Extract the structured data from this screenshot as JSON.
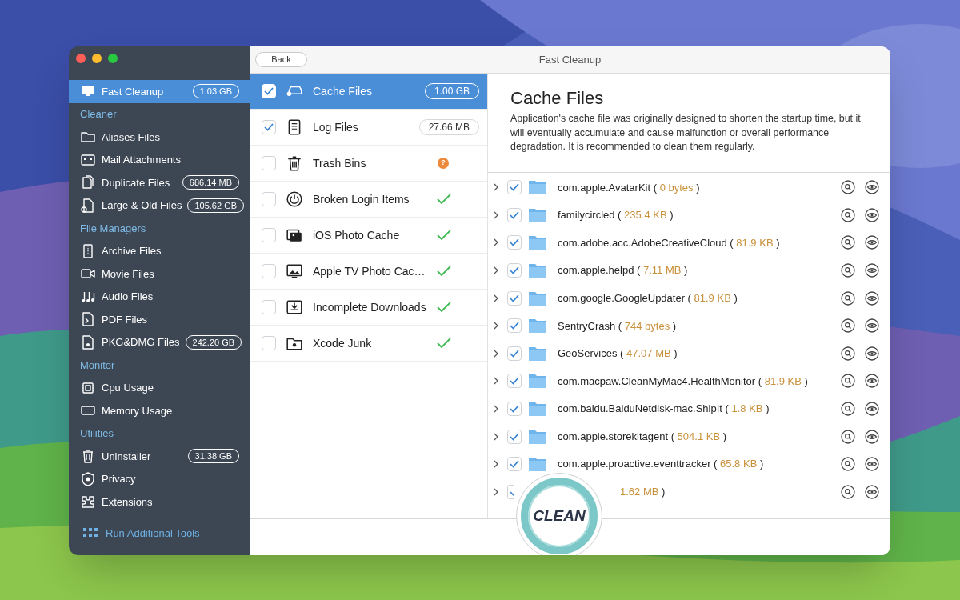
{
  "window": {
    "title": "Fast Cleanup"
  },
  "sidebar": {
    "entries": [
      {
        "kind": "item",
        "label": "Fast Cleanup",
        "badge": "1.03 GB",
        "selected": true
      },
      {
        "kind": "heading",
        "label": "Cleaner"
      },
      {
        "kind": "item",
        "label": "Aliases Files",
        "selected": false
      },
      {
        "kind": "item",
        "label": "Mail Attachments",
        "selected": false
      },
      {
        "kind": "item",
        "label": "Duplicate Files",
        "badge": "686.14 MB",
        "selected": false
      },
      {
        "kind": "item",
        "label": "Large & Old Files",
        "badge": "105.62 GB",
        "selected": false
      },
      {
        "kind": "heading",
        "label": "File Managers"
      },
      {
        "kind": "item",
        "label": "Archive Files",
        "selected": false
      },
      {
        "kind": "item",
        "label": "Movie Files",
        "selected": false
      },
      {
        "kind": "item",
        "label": "Audio Files",
        "selected": false
      },
      {
        "kind": "item",
        "label": "PDF Files",
        "selected": false
      },
      {
        "kind": "item",
        "label": "PKG&DMG Files",
        "badge": "242.20 GB",
        "selected": false
      },
      {
        "kind": "heading",
        "label": "Monitor"
      },
      {
        "kind": "item",
        "label": "Cpu Usage",
        "selected": false
      },
      {
        "kind": "item",
        "label": "Memory Usage",
        "selected": false
      },
      {
        "kind": "heading",
        "label": "Utilities"
      },
      {
        "kind": "item",
        "label": "Uninstaller",
        "badge": "31.38 GB",
        "selected": false
      },
      {
        "kind": "item",
        "label": "Privacy",
        "selected": false
      },
      {
        "kind": "item",
        "label": "Extensions",
        "selected": false
      }
    ],
    "footer_link": "Run Additional Tools"
  },
  "back_button": "Back",
  "categories": [
    {
      "label": "Cache Files",
      "checked": true,
      "selected": true,
      "kind": "size",
      "size": "1.00 GB"
    },
    {
      "label": "Log Files",
      "checked": true,
      "selected": false,
      "kind": "size",
      "size": "27.66 MB"
    },
    {
      "label": "Trash Bins",
      "checked": false,
      "selected": false,
      "kind": "unknown",
      "mark": "?"
    },
    {
      "label": "Broken Login Items",
      "checked": false,
      "selected": false,
      "kind": "ok"
    },
    {
      "label": "iOS Photo Cache",
      "checked": false,
      "selected": false,
      "kind": "ok"
    },
    {
      "label": "Apple TV Photo Cac…",
      "checked": false,
      "selected": false,
      "kind": "ok"
    },
    {
      "label": "Incomplete Downloads",
      "checked": false,
      "selected": false,
      "kind": "ok"
    },
    {
      "label": "Xcode Junk",
      "checked": false,
      "selected": false,
      "kind": "ok"
    }
  ],
  "detail": {
    "title": "Cache Files",
    "description": "Application's cache file was originally designed to shorten the startup time, but it will eventually accumulate and cause malfunction or overall performance degradation. It is recommended to clean them regularly."
  },
  "files": [
    {
      "label": "com.apple.AvatarKit (",
      "size": "0 bytes",
      "suffix": ")",
      "checked": true
    },
    {
      "label": "familycircled (",
      "size": "235.4 KB",
      "suffix": ")",
      "checked": true
    },
    {
      "label": "com.adobe.acc.AdobeCreativeCloud (",
      "size": "81.9 KB",
      "suffix": ")",
      "checked": true
    },
    {
      "label": "com.apple.helpd (",
      "size": "7.11 MB",
      "suffix": ")",
      "checked": true
    },
    {
      "label": "com.google.GoogleUpdater (",
      "size": "81.9 KB",
      "suffix": ")",
      "checked": true
    },
    {
      "label": "SentryCrash (",
      "size": "744 bytes",
      "suffix": ")",
      "checked": true
    },
    {
      "label": "GeoServices (",
      "size": "47.07 MB",
      "suffix": ")",
      "checked": true
    },
    {
      "label": "com.macpaw.CleanMyMac4.HealthMonitor (",
      "size": "81.9 KB",
      "suffix": ")",
      "checked": true
    },
    {
      "label": "com.baidu.BaiduNetdisk-mac.ShipIt (",
      "size": "1.8 KB",
      "suffix": ")",
      "checked": true
    },
    {
      "label": "com.apple.storekitagent (",
      "size": "504.1 KB",
      "suffix": ")",
      "checked": true
    },
    {
      "label": "com.apple.proactive.eventtracker (",
      "size": "65.8 KB",
      "suffix": ")",
      "checked": true
    },
    {
      "size": "1.62 MB",
      "suffix": ")",
      "checked": true
    }
  ],
  "clean_button": "CLEAN"
}
